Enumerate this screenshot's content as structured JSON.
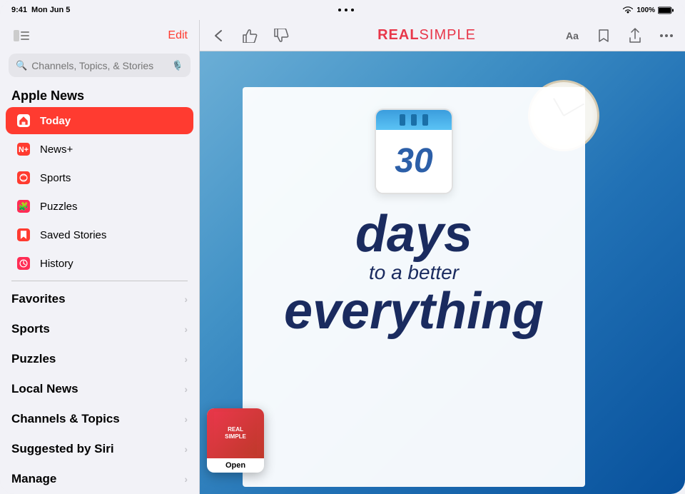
{
  "status_bar": {
    "time": "9:41",
    "day": "Mon Jun 5",
    "dots": 3,
    "wifi": "WiFi",
    "battery": "100%"
  },
  "sidebar": {
    "edit_label": "Edit",
    "search_placeholder": "Channels, Topics, & Stories",
    "section_label": "Apple News",
    "nav_items": [
      {
        "id": "today",
        "label": "Today",
        "icon": "apple-news-icon",
        "active": true
      },
      {
        "id": "news-plus",
        "label": "News+",
        "icon": "news-plus-icon",
        "active": false
      },
      {
        "id": "sports",
        "label": "Sports",
        "icon": "sports-icon",
        "active": false
      },
      {
        "id": "puzzles",
        "label": "Puzzles",
        "icon": "puzzles-icon",
        "active": false
      },
      {
        "id": "saved-stories",
        "label": "Saved Stories",
        "icon": "saved-icon",
        "active": false
      },
      {
        "id": "history",
        "label": "History",
        "icon": "history-icon",
        "active": false
      }
    ],
    "groups": [
      {
        "id": "favorites",
        "label": "Favorites"
      },
      {
        "id": "sports",
        "label": "Sports"
      },
      {
        "id": "puzzles",
        "label": "Puzzles"
      },
      {
        "id": "local-news",
        "label": "Local News"
      },
      {
        "id": "channels-topics",
        "label": "Channels & Topics"
      },
      {
        "id": "suggested-by-siri",
        "label": "Suggested by Siri"
      },
      {
        "id": "manage",
        "label": "Manage"
      }
    ]
  },
  "toolbar": {
    "back_icon": "←",
    "like_icon": "👍",
    "dislike_icon": "👎",
    "magazine_title": "REAL SIMPLE",
    "font_icon": "Aa",
    "bookmark_icon": "🔖",
    "share_icon": "⬆",
    "more_icon": "•••"
  },
  "article": {
    "calendar_number": "30",
    "headline_1": "days",
    "headline_2": "to a better",
    "headline_3": "everything"
  },
  "open_popup": {
    "label": "Open"
  }
}
